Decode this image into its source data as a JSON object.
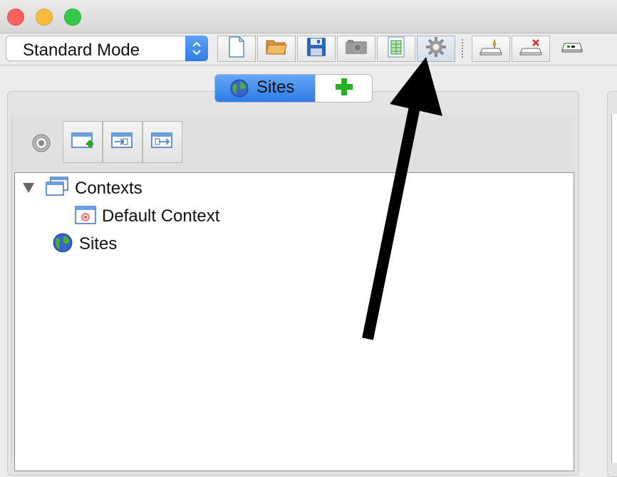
{
  "window": {
    "controls": [
      {
        "name": "close",
        "color": "#fc605c"
      },
      {
        "name": "minimize",
        "color": "#fdbc40"
      },
      {
        "name": "zoom",
        "color": "#34c84a"
      }
    ]
  },
  "toolbar": {
    "mode_selector": {
      "selected": "Standard Mode"
    },
    "buttons": [
      {
        "icon": "new-session-icon"
      },
      {
        "icon": "open-session-icon"
      },
      {
        "icon": "save-session-icon"
      },
      {
        "icon": "snapshot-icon"
      },
      {
        "icon": "session-properties-icon"
      },
      {
        "icon": "options-gear-icon"
      },
      {
        "icon": "show-all-tabs-icon"
      },
      {
        "icon": "hide-all-tabs-icon"
      },
      {
        "icon": "show-tab-names-icon"
      }
    ],
    "accent": "#2f7ae6"
  },
  "tabs": {
    "sites_label": "Sites",
    "add_icon": "plus-icon"
  },
  "sites_panel": {
    "toolbar_icons": [
      "target-icon",
      "new-context-icon",
      "import-context-icon",
      "export-context-icon"
    ],
    "tree": {
      "contexts_label": "Contexts",
      "default_context_label": "Default Context",
      "sites_label": "Sites"
    }
  },
  "annotation": {
    "type": "arrow",
    "points_to": "options-gear-icon",
    "color": "#000000"
  }
}
